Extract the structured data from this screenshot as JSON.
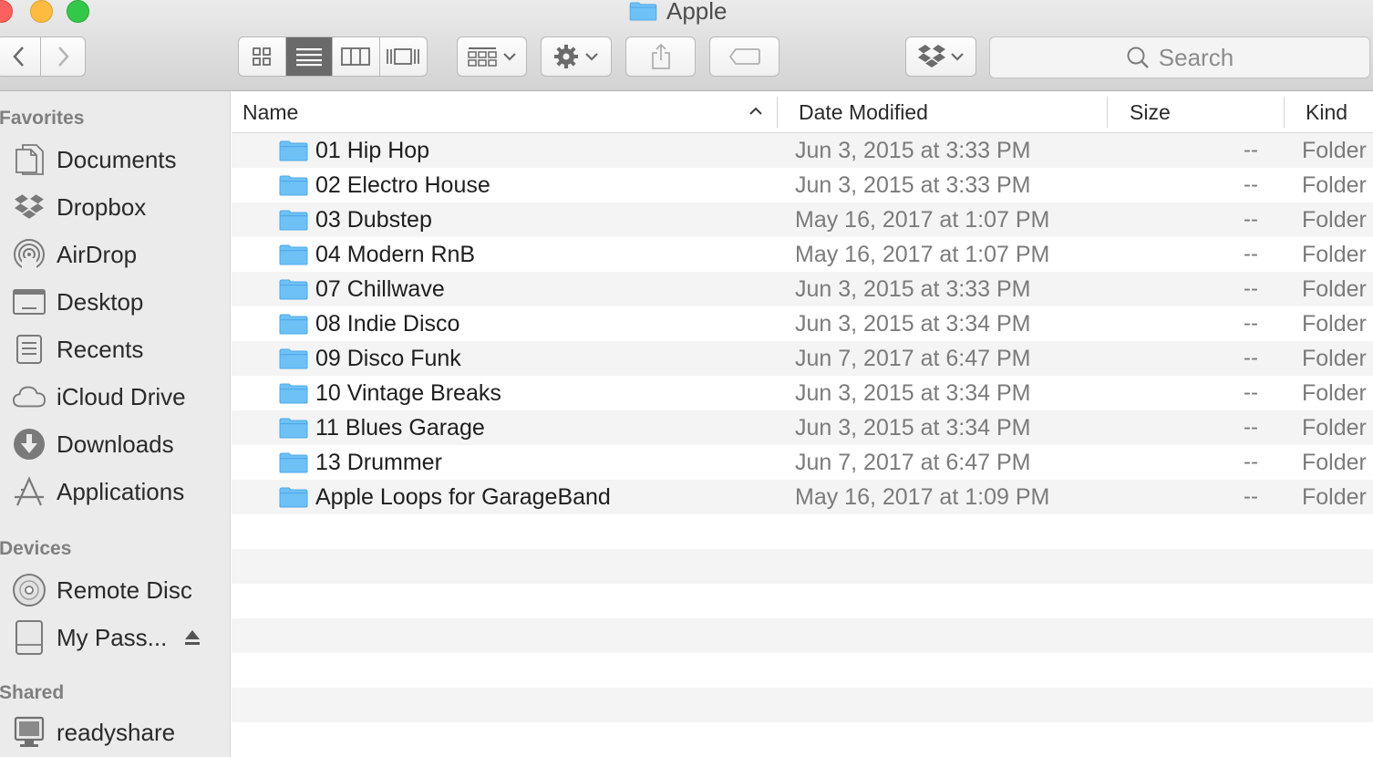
{
  "window": {
    "title": "Apple"
  },
  "toolbar": {
    "search_placeholder": "Search",
    "view_modes": [
      "icon-view-icon",
      "list-view-icon",
      "column-view-icon",
      "cover-flow-icon"
    ],
    "active_view": "list"
  },
  "sidebar": {
    "favorites_heading": "Favorites",
    "favorites": [
      {
        "label": "Documents",
        "icon": "documents-icon"
      },
      {
        "label": "Dropbox",
        "icon": "dropbox-icon"
      },
      {
        "label": "AirDrop",
        "icon": "airdrop-icon"
      },
      {
        "label": "Desktop",
        "icon": "desktop-icon"
      },
      {
        "label": "Recents",
        "icon": "recents-icon"
      },
      {
        "label": "iCloud Drive",
        "icon": "cloud-icon"
      },
      {
        "label": "Downloads",
        "icon": "downloads-icon"
      },
      {
        "label": "Applications",
        "icon": "applications-icon"
      }
    ],
    "devices_heading": "Devices",
    "devices": [
      {
        "label": "Remote Disc",
        "icon": "disc-icon"
      },
      {
        "label": "My Pass...",
        "icon": "drive-icon"
      }
    ],
    "shared_heading": "Shared",
    "shared": [
      {
        "label": "readyshare",
        "icon": "monitor-icon"
      }
    ]
  },
  "columns": {
    "name": "Name",
    "date": "Date Modified",
    "size": "Size",
    "kind": "Kind"
  },
  "files": [
    {
      "name": "01 Hip Hop",
      "date": "Jun 3, 2015 at 3:33 PM",
      "size": "--",
      "kind": "Folder"
    },
    {
      "name": "02 Electro House",
      "date": "Jun 3, 2015 at 3:33 PM",
      "size": "--",
      "kind": "Folder"
    },
    {
      "name": "03 Dubstep",
      "date": "May 16, 2017 at 1:07 PM",
      "size": "--",
      "kind": "Folder"
    },
    {
      "name": "04 Modern RnB",
      "date": "May 16, 2017 at 1:07 PM",
      "size": "--",
      "kind": "Folder"
    },
    {
      "name": "07 Chillwave",
      "date": "Jun 3, 2015 at 3:33 PM",
      "size": "--",
      "kind": "Folder"
    },
    {
      "name": "08 Indie Disco",
      "date": "Jun 3, 2015 at 3:34 PM",
      "size": "--",
      "kind": "Folder"
    },
    {
      "name": "09 Disco Funk",
      "date": "Jun 7, 2017 at 6:47 PM",
      "size": "--",
      "kind": "Folder"
    },
    {
      "name": "10 Vintage Breaks",
      "date": "Jun 3, 2015 at 3:34 PM",
      "size": "--",
      "kind": "Folder"
    },
    {
      "name": "11 Blues Garage",
      "date": "Jun 3, 2015 at 3:34 PM",
      "size": "--",
      "kind": "Folder"
    },
    {
      "name": "13 Drummer",
      "date": "Jun 7, 2017 at 6:47 PM",
      "size": "--",
      "kind": "Folder"
    },
    {
      "name": "Apple Loops for GarageBand",
      "date": "May 16, 2017 at 1:09 PM",
      "size": "--",
      "kind": "Folder"
    }
  ],
  "colors": {
    "folder_blue": "#6ec1f5",
    "folder_tab": "#4fa9e8",
    "active_segment": "#6a6a6a",
    "zebra": "#f4f4f4"
  }
}
